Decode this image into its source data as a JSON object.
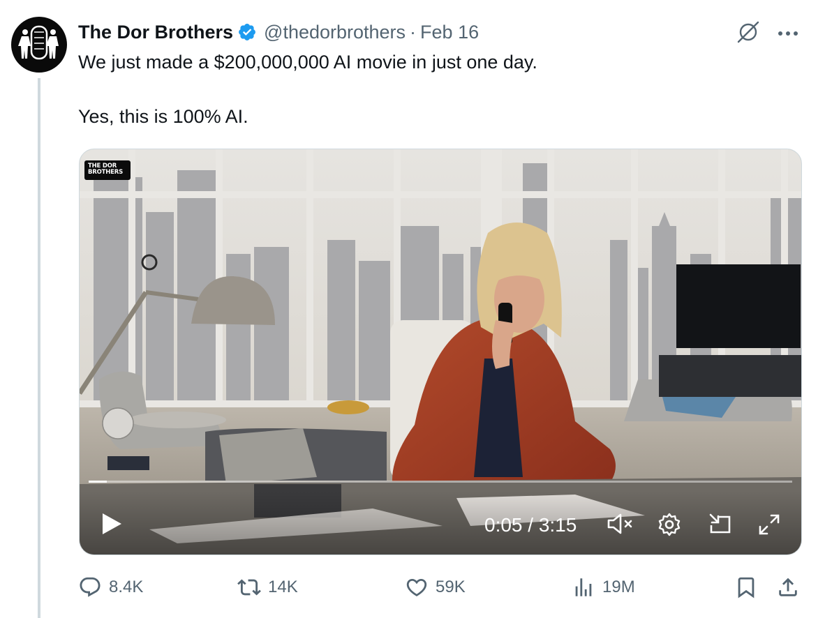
{
  "author": {
    "name": "The Dor Brothers",
    "handle": "@thedorbrothers",
    "separator": "·",
    "date": "Feb 16"
  },
  "tweet": {
    "lines": [
      "We just made a $200,000,000 AI movie in just one day.",
      "Yes, this is 100% AI."
    ]
  },
  "video": {
    "watermark_line1": "THE DOR",
    "watermark_line2": "BROTHERS",
    "time_display": "0:05 / 3:15",
    "progress_fraction": 0.026
  },
  "actions": {
    "replies": "8.4K",
    "reposts": "14K",
    "likes": "59K",
    "views": "19M"
  },
  "colors": {
    "text": "#0f1419",
    "muted": "#536471",
    "verified": "#1d9bf0",
    "thread_line": "#cfd9de"
  },
  "icons": [
    "verified-badge-icon",
    "grok-icon",
    "more-icon",
    "play-icon",
    "mute-icon",
    "settings-icon",
    "pip-icon",
    "fullscreen-icon",
    "reply-icon",
    "repost-icon",
    "like-icon",
    "views-icon",
    "bookmark-icon",
    "share-icon"
  ]
}
